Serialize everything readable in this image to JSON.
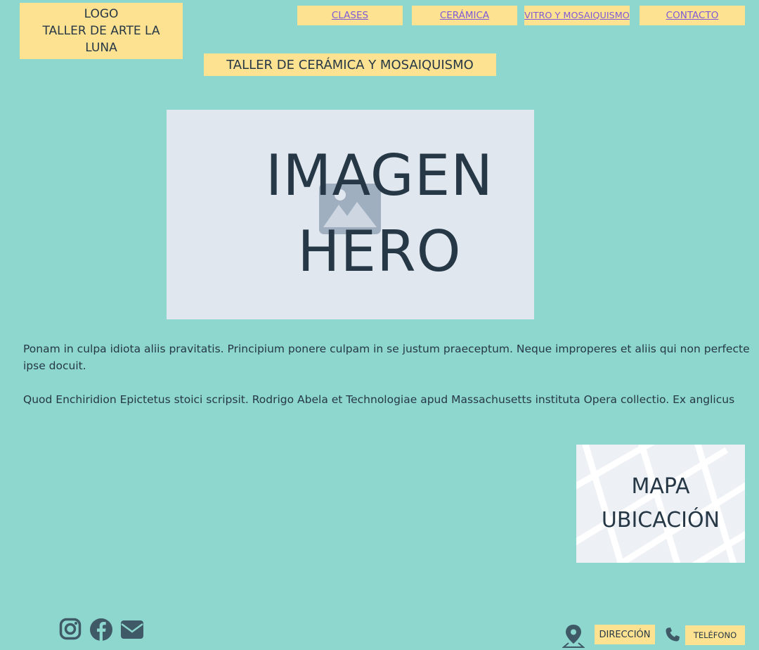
{
  "header": {
    "logo_lines": [
      "LOGO",
      "TALLER DE ARTE LA",
      "LUNA"
    ],
    "nav": [
      {
        "label": "CLASES"
      },
      {
        "label": "CERÁMICA"
      },
      {
        "label": "VITRO Y MOSAIQUISMO"
      },
      {
        "label": "CONTACTO"
      }
    ]
  },
  "page_title": "TALLER DE CERÁMICA Y MOSAIQUISMO",
  "hero": {
    "line1": "IMAGEN",
    "line2": "HERO",
    "icon": "image-placeholder-icon"
  },
  "body": {
    "paragraph1": "Ponam in culpa idiota aliis pravitatis. Principium ponere culpam in se justum praeceptum. Neque improperes et aliis qui non perfecte ipse docuit.",
    "paragraph2": "Quod Enchiridion Epictetus stoici scripsit. Rodrigo Abela et Technologiae apud Massachusetts instituta Opera collectio. Ex anglicus"
  },
  "map": {
    "line1": "MAPA",
    "line2": "UBICACIÓN"
  },
  "footer": {
    "social_icons": [
      "instagram-icon",
      "facebook-icon",
      "mail-icon"
    ],
    "address_label": "DIRECCIÓN",
    "phone_label": "TELÉFONO"
  },
  "colors": {
    "background": "#8dd7cf",
    "label_fill": "#fde291",
    "text": "#263746",
    "link": "#7d5bd6",
    "placeholder": "#e1e7ef"
  }
}
